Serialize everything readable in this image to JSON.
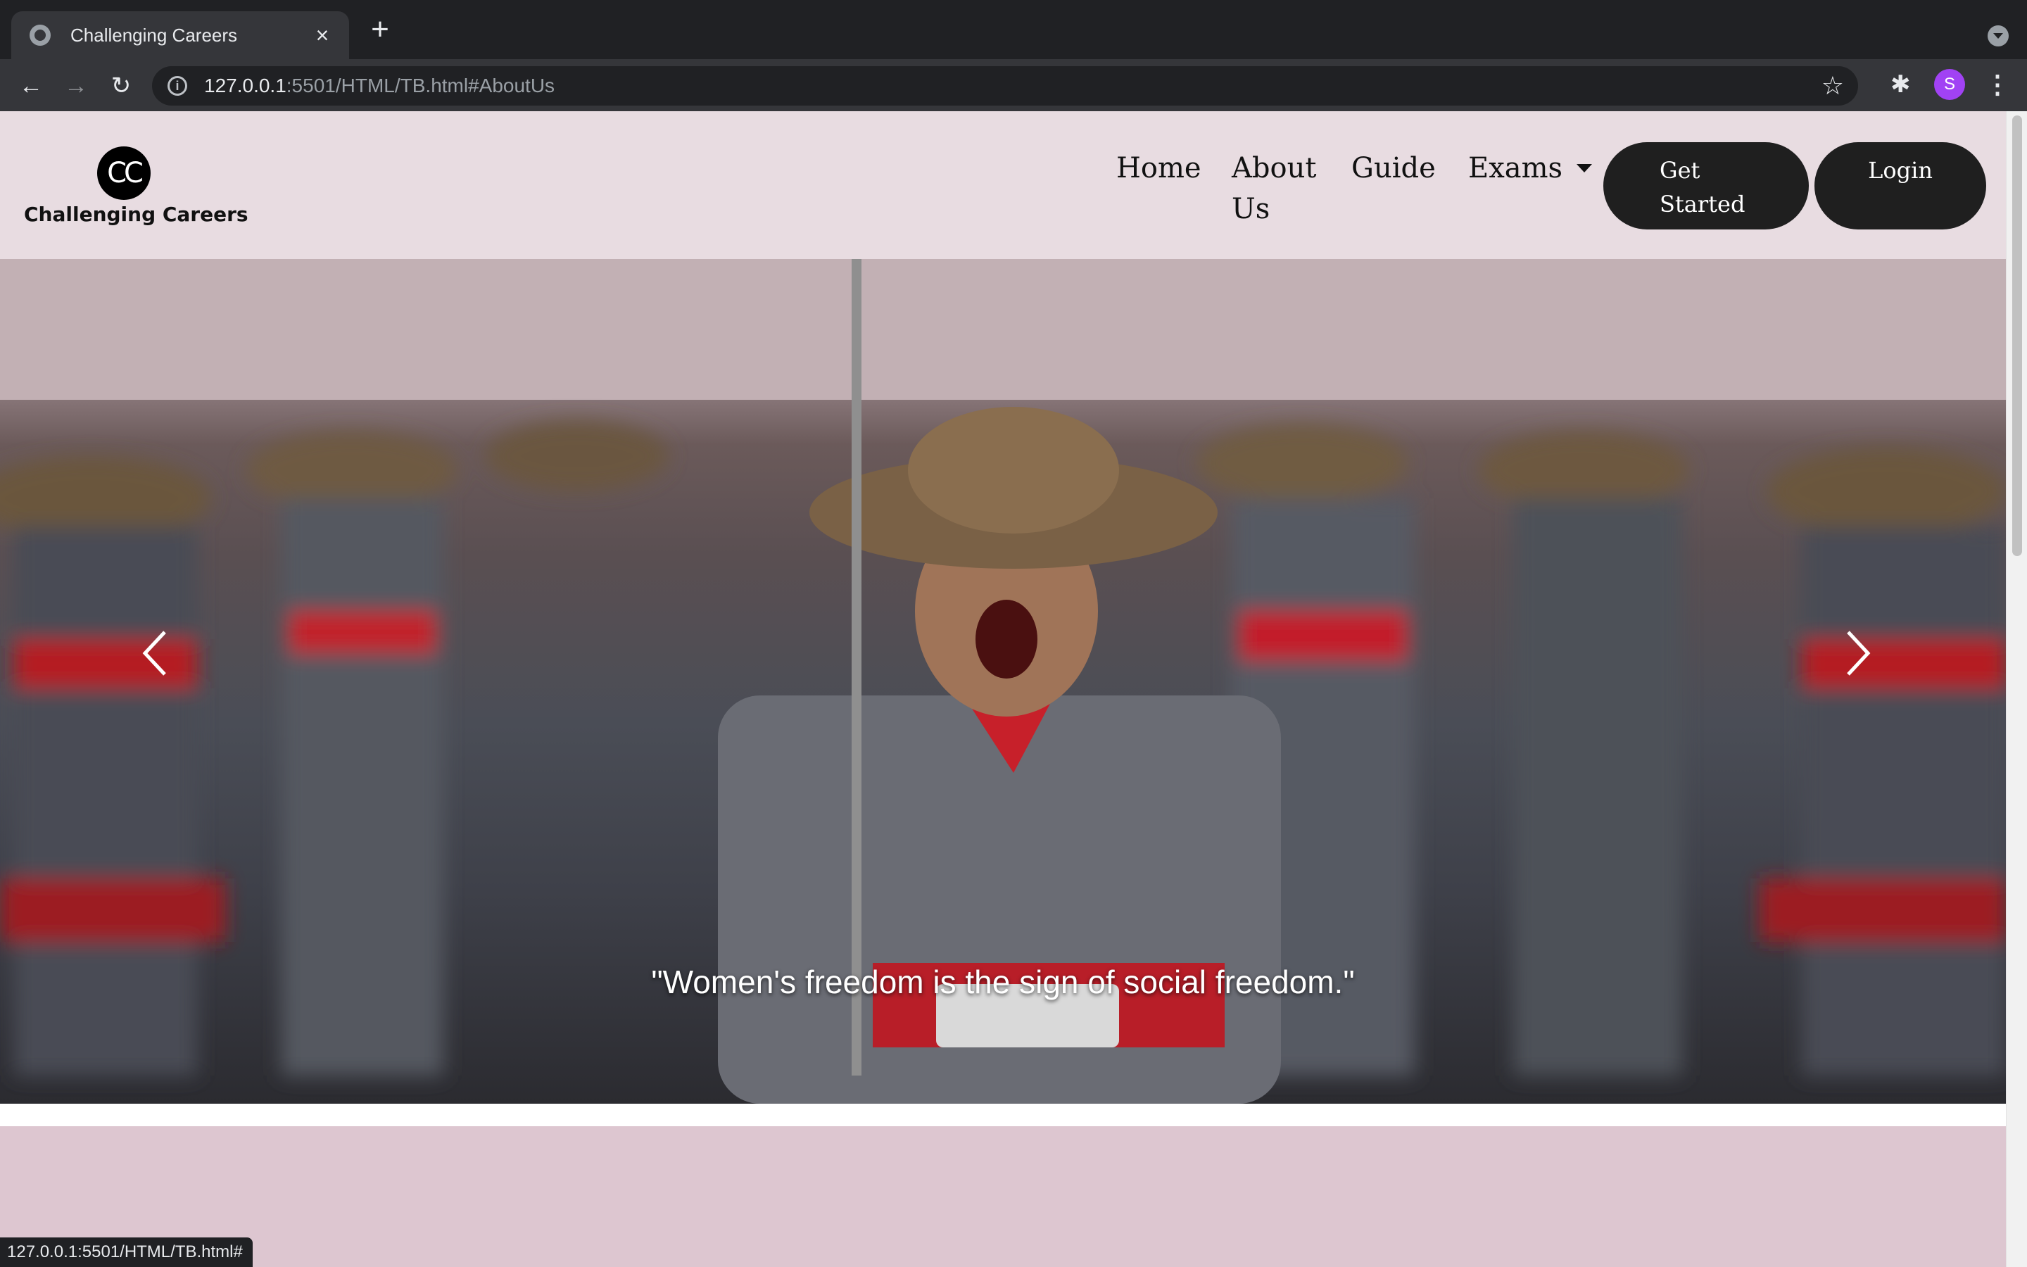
{
  "browser": {
    "tab": {
      "title": "Challenging Careers",
      "close_glyph": "×"
    },
    "new_tab_glyph": "+",
    "back_glyph": "←",
    "forward_glyph": "→",
    "reload_glyph": "↻",
    "url_host": "127.0.0.1",
    "url_rest": ":5501/HTML/TB.html#AboutUs",
    "star_glyph": "☆",
    "extensions_glyph": "✱",
    "profile_initial": "S",
    "menu_glyph": "⋮",
    "status_url": "127.0.0.1:5501/HTML/TB.html#"
  },
  "site": {
    "logo": {
      "mark": "CC",
      "name": "Challenging Careers"
    },
    "nav": {
      "home": "Home",
      "about": "About Us",
      "guide": "Guide",
      "exams": "Exams",
      "get_started": "Get Started",
      "login": "Login"
    },
    "hero": {
      "quote": "\"Women's freedom is the sign of social freedom.\""
    }
  },
  "colors": {
    "header_bg": "#e8dce1",
    "section_bg": "#ddc6d0",
    "button_bg": "#1f1f1f",
    "chrome_bg": "#202124",
    "toolbar_bg": "#35363a"
  },
  "icons": {
    "tab_favicon": "globe-icon",
    "info": "info-icon",
    "bookmark": "star-icon",
    "extensions": "puzzle-icon",
    "dropdown": "caret-down-icon",
    "carousel_prev": "chevron-left-icon",
    "carousel_next": "chevron-right-icon"
  }
}
